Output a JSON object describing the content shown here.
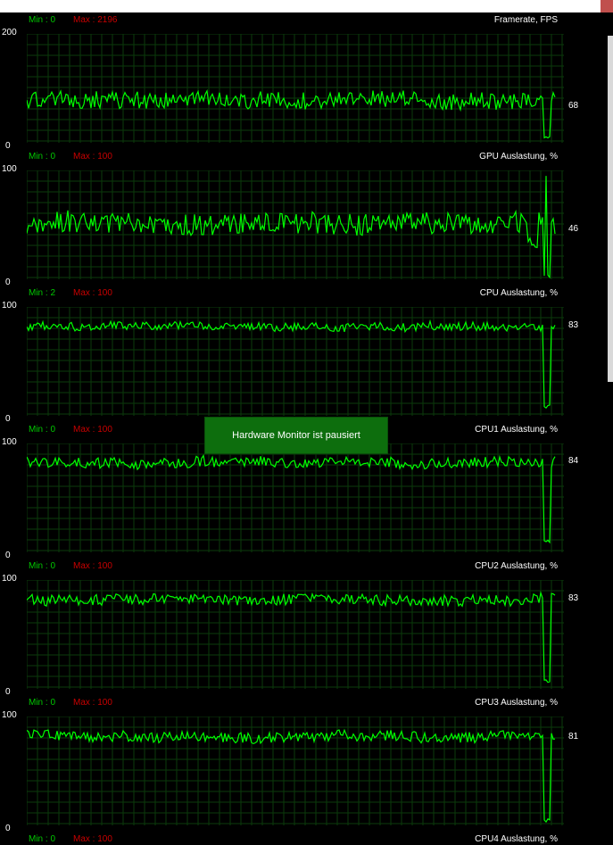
{
  "colors": {
    "background": "#000000",
    "grid": "#0b3b0b",
    "trace": "#00ff00",
    "min_label": "#00c800",
    "max_label": "#c80000",
    "text": "#ffffff",
    "pause_badge": "#0d6e0d",
    "close_box": "#c0504d"
  },
  "pause_message": "Hardware Monitor ist pausiert",
  "graphs": [
    {
      "id": "fps",
      "title": "Framerate, FPS",
      "min_label": "Min : 0",
      "max_label": "Max : 2196",
      "axis_max": "200",
      "axis_min": "0",
      "current": "68",
      "scale_max": 200,
      "current_value": 68,
      "baseline": 78,
      "noise": 0.08,
      "dip_level": 0.02
    },
    {
      "id": "gpu",
      "title": "GPU Auslastung, %",
      "min_label": "Min : 0",
      "max_label": "Max : 100",
      "axis_max": "100",
      "axis_min": "0",
      "current": "46",
      "scale_max": 100,
      "current_value": 46,
      "baseline": 0.52,
      "noise": 0.1,
      "dip_level": 0.0
    },
    {
      "id": "cpu",
      "title": "CPU Auslastung, %",
      "min_label": "Min : 2",
      "max_label": "Max : 100",
      "axis_max": "100",
      "axis_min": "0",
      "current": "83",
      "scale_max": 100,
      "current_value": 83,
      "baseline": 0.82,
      "noise": 0.04,
      "dip_level": 0.06
    },
    {
      "id": "cpu1",
      "title": "CPU1 Auslastung, %",
      "min_label": "Min : 0",
      "max_label": "Max : 100",
      "axis_max": "100",
      "axis_min": "0",
      "current": "84",
      "scale_max": 100,
      "current_value": 84,
      "baseline": 0.83,
      "noise": 0.05,
      "dip_level": 0.08
    },
    {
      "id": "cpu2",
      "title": "CPU2 Auslastung, %",
      "min_label": "Min : 0",
      "max_label": "Max : 100",
      "axis_max": "100",
      "axis_min": "0",
      "current": "83",
      "scale_max": 100,
      "current_value": 83,
      "baseline": 0.82,
      "noise": 0.05,
      "dip_level": 0.06
    },
    {
      "id": "cpu3",
      "title": "CPU3 Auslastung, %",
      "min_label": "Min : 0",
      "max_label": "Max : 100",
      "axis_max": "100",
      "axis_min": "0",
      "current": "81",
      "scale_max": 100,
      "current_value": 81,
      "baseline": 0.82,
      "noise": 0.05,
      "dip_level": 0.03
    }
  ],
  "footer_graph": {
    "title": "CPU4 Auslastung, %",
    "min_label": "Min : 0",
    "max_label": "Max : 100"
  }
}
